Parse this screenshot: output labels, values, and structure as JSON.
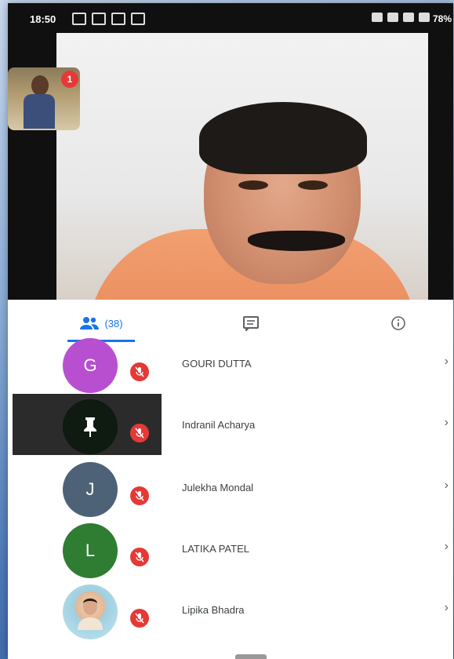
{
  "status_bar": {
    "time": "18:50",
    "battery": "78%"
  },
  "self_view": {
    "notification_count": "1"
  },
  "tabs": {
    "people_count": "(38)",
    "people_icon": "people-icon",
    "chat_icon": "chat-icon",
    "info_icon": "info-icon"
  },
  "participants": [
    {
      "initial": "G",
      "name": "GOURI DUTTA",
      "avatar_color": "#b84fd1",
      "muted": true
    },
    {
      "initial": "",
      "name": "Indranil Acharya",
      "avatar_color": "#0f1a10",
      "muted": true,
      "pinned": true
    },
    {
      "initial": "J",
      "name": "Julekha Mondal",
      "avatar_color": "#4d6277",
      "muted": true
    },
    {
      "initial": "L",
      "name": "LATIKA PATEL",
      "avatar_color": "#2e7d32",
      "muted": true
    },
    {
      "initial": "",
      "name": "Lipika Bhadra",
      "avatar_color": "#bfe4ef",
      "muted": true
    }
  ],
  "colors": {
    "accent": "#1a73e8",
    "mute_red": "#e53935"
  }
}
